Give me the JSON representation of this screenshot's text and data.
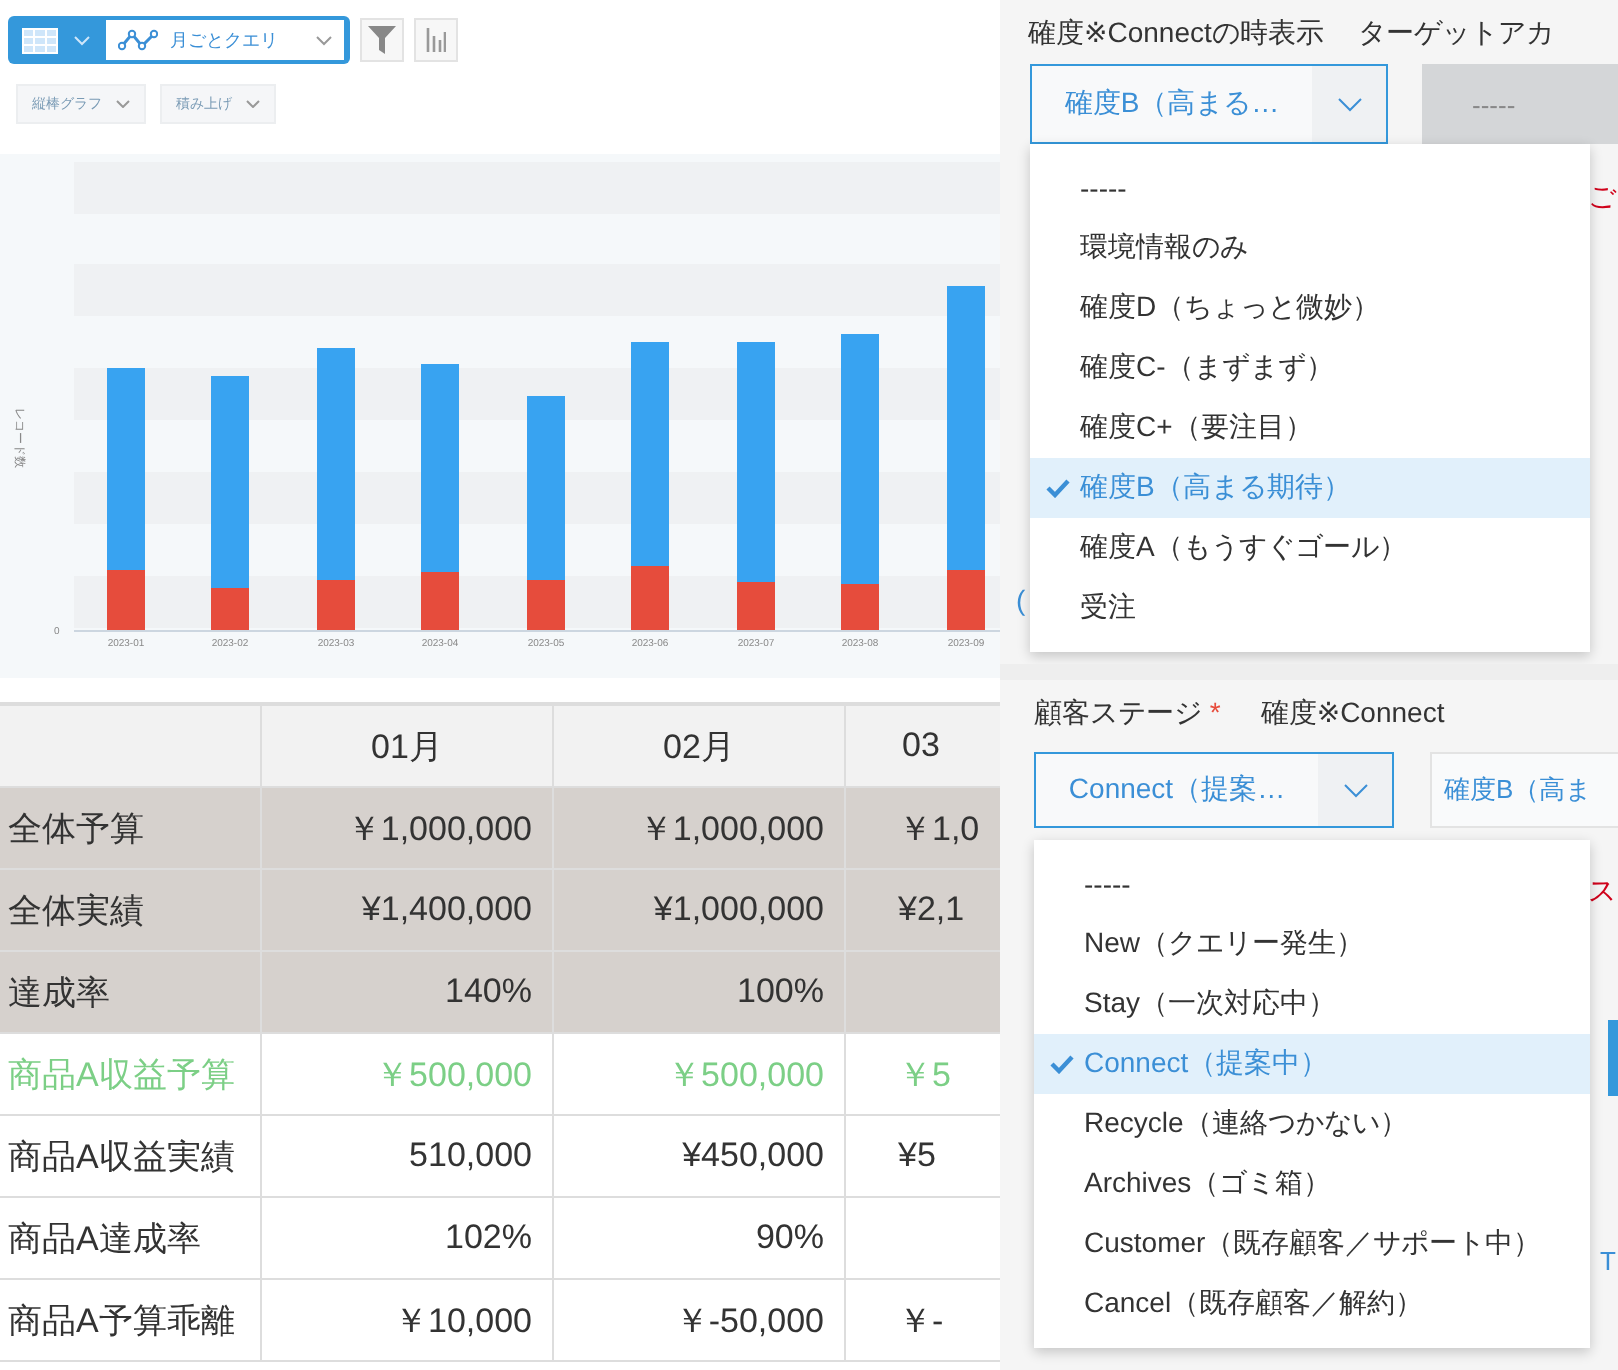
{
  "toolbar": {
    "query": "月ごとクエリ",
    "chart_type": "縦棒グラフ",
    "stack_mode": "積み上げ"
  },
  "chart": {
    "y_label": "レコード数",
    "y_zero": "0",
    "x_labels": [
      "2023-01",
      "2023-02",
      "2023-03",
      "2023-04",
      "2023-05",
      "2023-06",
      "2023-07",
      "2023-08",
      "2023-09"
    ]
  },
  "table": {
    "columns": [
      "01月",
      "02月",
      "03"
    ],
    "rows": [
      {
        "label": "全体予算",
        "kind": "summary",
        "cells": [
          "￥1,000,000",
          "￥1,000,000",
          "￥1,0"
        ]
      },
      {
        "label": "全体実績",
        "kind": "summary",
        "cells": [
          "¥1,400,000",
          "¥1,000,000",
          "¥2,1"
        ]
      },
      {
        "label": "達成率",
        "kind": "summary",
        "cells": [
          "140%",
          "100%"
        ]
      },
      {
        "label": "商品A収益予算",
        "kind": "budget",
        "cells": [
          "￥500,000",
          "￥500,000",
          "￥5"
        ]
      },
      {
        "label": "商品A収益実績",
        "kind": "normal",
        "cells": [
          "510,000",
          "¥450,000",
          "¥5"
        ]
      },
      {
        "label": "商品A達成率",
        "kind": "normal",
        "cells": [
          "102%",
          "90%"
        ]
      },
      {
        "label": "商品A予算乖離",
        "kind": "normal",
        "cells": [
          "￥10,000",
          "￥-50,000",
          "￥-"
        ]
      }
    ]
  },
  "confidence_panel": {
    "label": "確度※Connectの時表示",
    "other_label": "ターゲットアカ",
    "value": "確度B（高まる…",
    "other_value": "-----",
    "partial_left": "(",
    "partial_right": "ご",
    "menu": [
      {
        "label": "-----",
        "selected": false
      },
      {
        "label": "環境情報のみ",
        "selected": false
      },
      {
        "label": "確度D（ちょっと微妙）",
        "selected": false
      },
      {
        "label": "確度C-（まずまず）",
        "selected": false
      },
      {
        "label": "確度C+（要注目）",
        "selected": false
      },
      {
        "label": "確度B（高まる期待）",
        "selected": true
      },
      {
        "label": "確度A（もうすぐゴール）",
        "selected": false
      },
      {
        "label": "受注",
        "selected": false
      }
    ]
  },
  "stage_panel": {
    "label": "顧客ステージ",
    "required_mark": "*",
    "other_label": "確度※Connect",
    "value": "Connect（提案…",
    "other_value": "確度B（高ま",
    "partial_alert": "ス",
    "partial_button_text": "T",
    "menu": [
      {
        "label": "-----",
        "selected": false
      },
      {
        "label": "New（クエリー発生）",
        "selected": false
      },
      {
        "label": "Stay（一次対応中）",
        "selected": false
      },
      {
        "label": "Connect（提案中）",
        "selected": true
      },
      {
        "label": "Recycle（連絡つかない）",
        "selected": false
      },
      {
        "label": "Archives（ゴミ箱）",
        "selected": false
      },
      {
        "label": "Customer（既存顧客／サポート中）",
        "selected": false
      },
      {
        "label": "Cancel（既存顧客／解約）",
        "selected": false
      }
    ]
  }
}
